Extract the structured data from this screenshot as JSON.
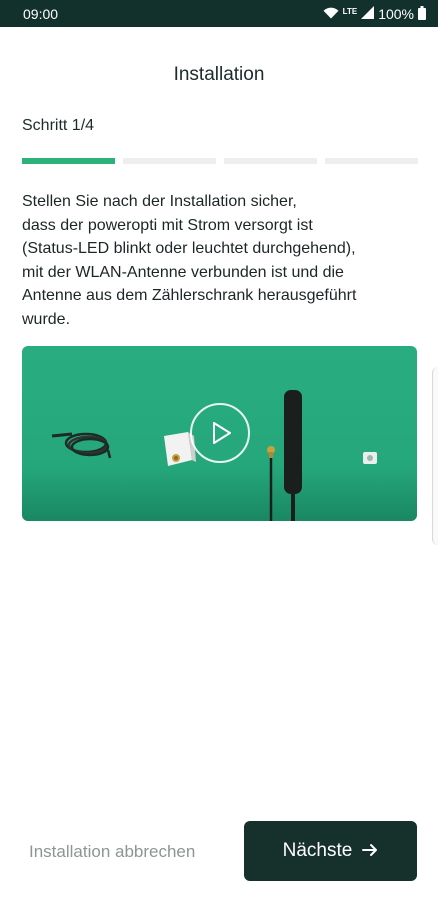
{
  "status_bar": {
    "time": "09:00",
    "network": "LTE",
    "battery": "100%",
    "icons": [
      "wifi-icon",
      "signal-icon",
      "battery-icon"
    ]
  },
  "header": {
    "title": "Installation"
  },
  "stepper": {
    "label": "Schritt 1/4",
    "current": 1,
    "total": 4
  },
  "content": {
    "text_lines": [
      "Stellen Sie nach der Installation sicher,",
      "dass der poweropti mit Strom versorgt ist",
      "(Status-LED blinkt oder leuchtet durchgehend),",
      "mit der WLAN-Antenne verbunden ist und die",
      "Antenne aus dem Zählerschrank herausgeführt",
      "wurde."
    ]
  },
  "video": {
    "play_icon": "play-icon",
    "background": "#29ad80"
  },
  "footer": {
    "cancel_label": "Installation abbrechen",
    "next_label": "Nächste",
    "next_icon": "arrow-right-icon"
  },
  "colors": {
    "accent": "#2db37a",
    "dark": "#16302b",
    "muted": "#8d9595"
  }
}
